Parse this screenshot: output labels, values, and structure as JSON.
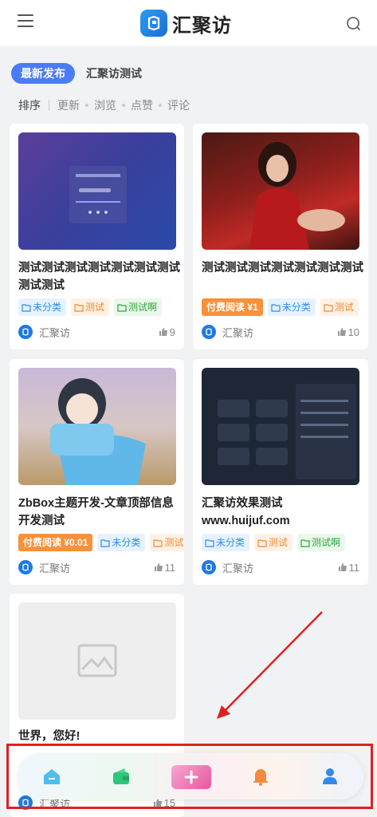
{
  "header": {
    "brand": "汇聚访",
    "menu_icon": "menu-icon",
    "search_icon": "search-icon"
  },
  "tabs": {
    "active": "最新发布",
    "other": "汇聚访测试"
  },
  "sortbar": {
    "label": "排序",
    "items": [
      "更新",
      "浏览",
      "点赞",
      "评论"
    ]
  },
  "cards": [
    {
      "title": "测试测试测试测试测试测试测试测试测试",
      "tags": [
        "未分类",
        "测试",
        "测试啊"
      ],
      "author": "汇聚访",
      "likes": "9"
    },
    {
      "title": "测试测试测试测试测试测试测试",
      "paid": "付费阅读 ¥1",
      "tags": [
        "未分类",
        "测试"
      ],
      "author": "汇聚访",
      "likes": "10"
    },
    {
      "title": "ZbBox主题开发-文章顶部信息开发测试",
      "paid": "付费阅读 ¥0.01",
      "tags": [
        "未分类",
        "测试"
      ],
      "author": "汇聚访",
      "likes": "11"
    },
    {
      "title": "汇聚访效果测试 www.huijuf.com",
      "tags": [
        "未分类",
        "测试",
        "测试啊"
      ],
      "author": "汇聚访",
      "likes": "11"
    },
    {
      "title": "世界，您好!",
      "author": "汇聚访",
      "likes": "15"
    }
  ],
  "bottom_nav": {
    "items": [
      "home-icon",
      "wallet-icon",
      "add-icon",
      "bell-icon",
      "user-icon"
    ]
  },
  "colors": {
    "accent": "#4a7cf7",
    "annotation": "#e02020"
  }
}
